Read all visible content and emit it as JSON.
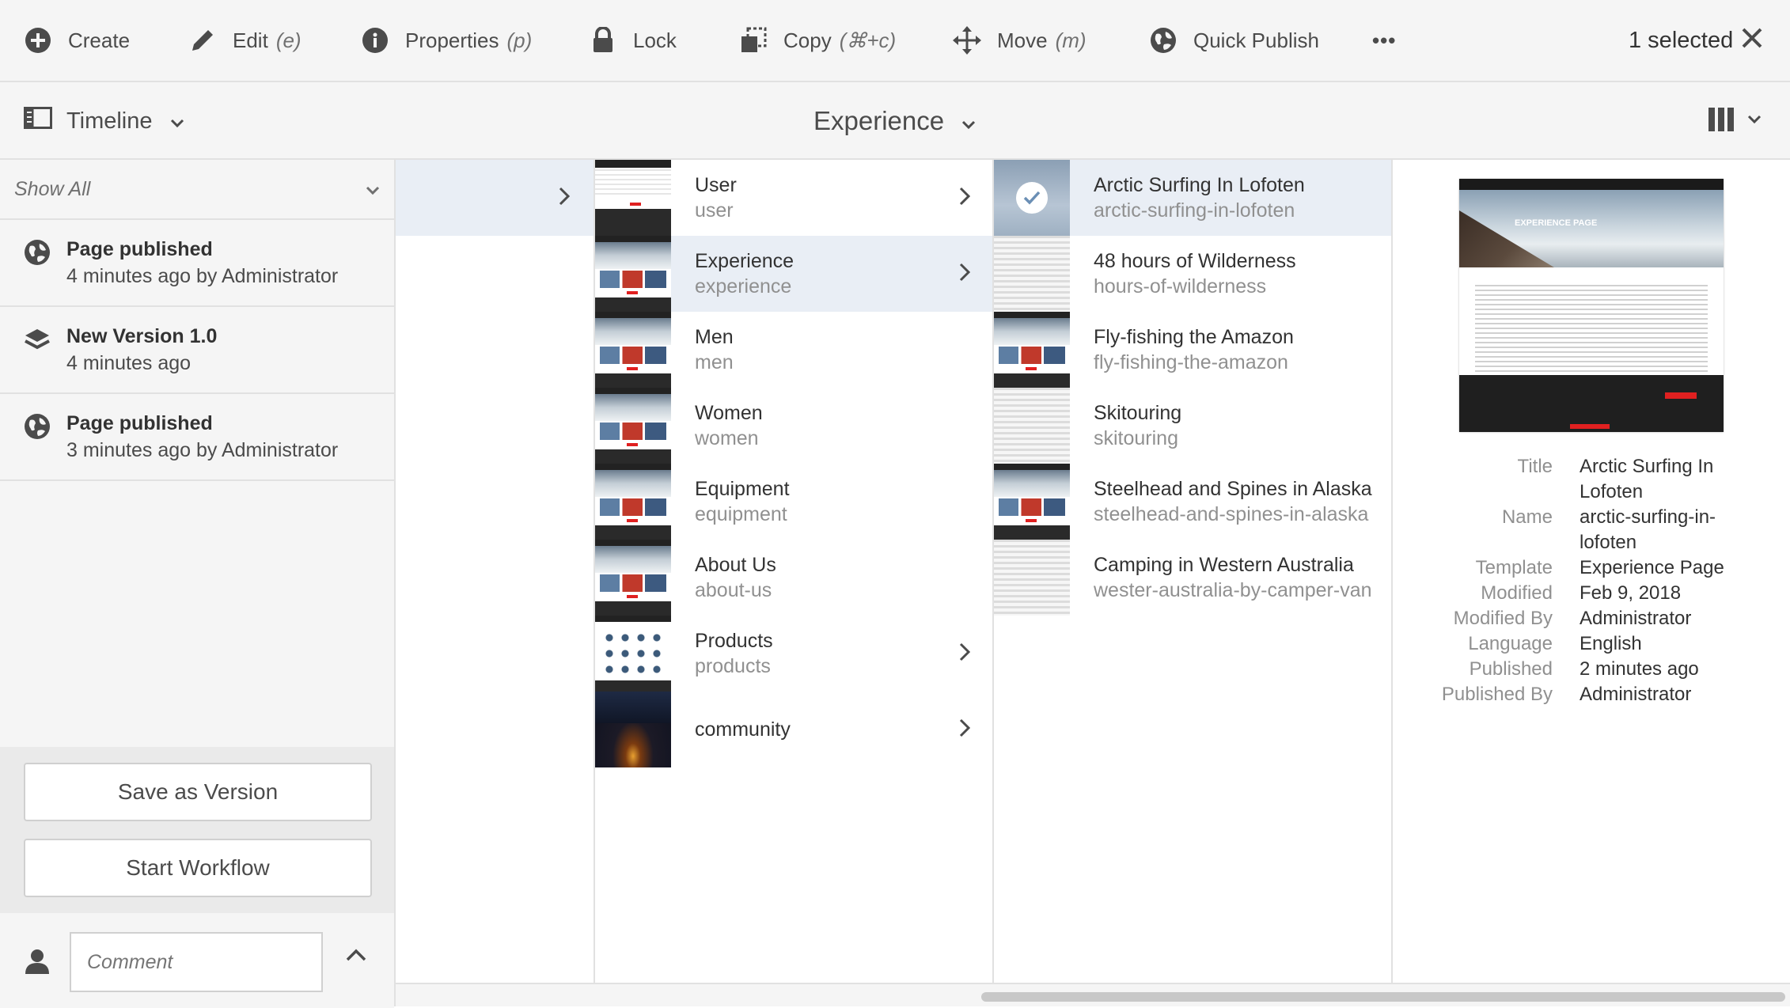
{
  "toolbar": {
    "create": "Create",
    "edit": "Edit",
    "edit_shortcut": "(e)",
    "properties": "Properties",
    "properties_shortcut": "(p)",
    "lock": "Lock",
    "copy": "Copy",
    "copy_shortcut": "(⌘+c)",
    "move": "Move",
    "move_shortcut": "(m)",
    "quick_publish": "Quick Publish",
    "more": "•••",
    "selection_count": "1 selected"
  },
  "header": {
    "rail_label": "Timeline",
    "title": "Experience"
  },
  "rail": {
    "filter_label": "Show All",
    "timeline": [
      {
        "icon": "globe-icon",
        "title": "Page published",
        "sub": "4 minutes ago by Administrator"
      },
      {
        "icon": "layers-icon",
        "title": "New Version 1.0",
        "sub": "4 minutes ago"
      },
      {
        "icon": "globe-icon",
        "title": "Page published",
        "sub": "3 minutes ago by Administrator"
      }
    ],
    "save_version": "Save as Version",
    "start_workflow": "Start Workflow",
    "comment_placeholder": "Comment"
  },
  "column1": [
    {
      "title": "User",
      "name": "user",
      "has_children": true
    },
    {
      "title": "Experience",
      "name": "experience",
      "has_children": true,
      "active": true
    },
    {
      "title": "Men",
      "name": "men",
      "has_children": false
    },
    {
      "title": "Women",
      "name": "women",
      "has_children": false
    },
    {
      "title": "Equipment",
      "name": "equipment",
      "has_children": false
    },
    {
      "title": "About Us",
      "name": "about-us",
      "has_children": false
    },
    {
      "title": "Products",
      "name": "products",
      "has_children": true
    },
    {
      "title": "community",
      "name": "",
      "has_children": true
    }
  ],
  "column2": [
    {
      "title": "Arctic Surfing In Lofoten",
      "name": "arctic-surfing-in-lofoten",
      "selected": true
    },
    {
      "title": "48 hours of Wilderness",
      "name": "hours-of-wilderness"
    },
    {
      "title": "Fly-fishing the Amazon",
      "name": "fly-fishing-the-amazon"
    },
    {
      "title": "Skitouring",
      "name": "skitouring"
    },
    {
      "title": "Steelhead and Spines in Alaska",
      "name": "steelhead-and-spines-in-alaska"
    },
    {
      "title": "Camping in Western Australia",
      "name": "wester-australia-by-camper-van"
    }
  ],
  "details": {
    "preview_heading": "EXPERIENCE PAGE",
    "rows": [
      {
        "label": "Title",
        "value": "Arctic Surfing In Lofoten"
      },
      {
        "label": "Name",
        "value": "arctic-surfing-in-lofoten"
      },
      {
        "label": "Template",
        "value": "Experience Page"
      },
      {
        "label": "Modified",
        "value": "Feb 9, 2018"
      },
      {
        "label": "Modified By",
        "value": "Administrator"
      },
      {
        "label": "Language",
        "value": "English"
      },
      {
        "label": "Published",
        "value": "2 minutes ago"
      },
      {
        "label": "Published By",
        "value": "Administrator"
      }
    ]
  },
  "colors": {
    "selected_row": "#e9eef5",
    "toolbar_bg": "#f5f5f5",
    "accent_red": "#e02020"
  }
}
